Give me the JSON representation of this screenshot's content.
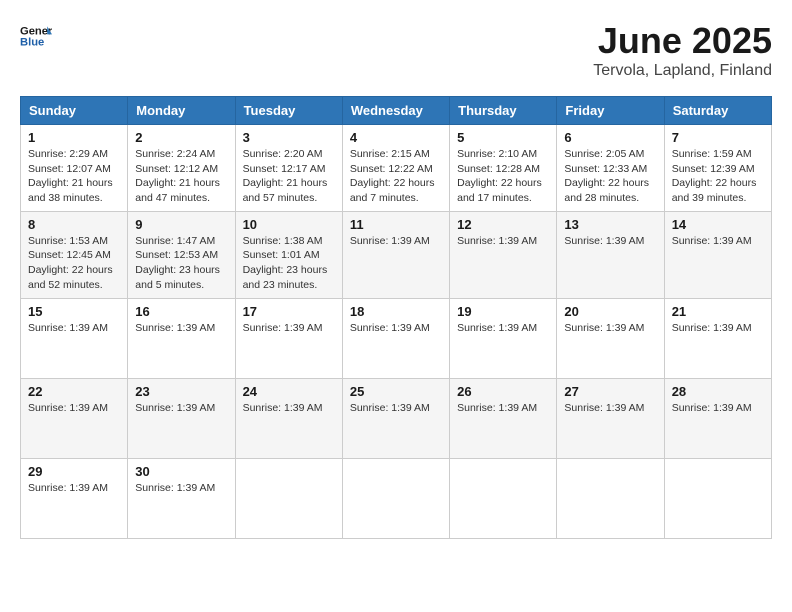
{
  "header": {
    "logo_line1": "General",
    "logo_line2": "Blue",
    "month": "June 2025",
    "location": "Tervola, Lapland, Finland"
  },
  "weekdays": [
    "Sunday",
    "Monday",
    "Tuesday",
    "Wednesday",
    "Thursday",
    "Friday",
    "Saturday"
  ],
  "weeks": [
    [
      {
        "day": "1",
        "info": "Sunrise: 2:29 AM\nSunset: 12:07 AM\nDaylight: 21 hours and 38 minutes."
      },
      {
        "day": "2",
        "info": "Sunrise: 2:24 AM\nSunset: 12:12 AM\nDaylight: 21 hours and 47 minutes."
      },
      {
        "day": "3",
        "info": "Sunrise: 2:20 AM\nSunset: 12:17 AM\nDaylight: 21 hours and 57 minutes."
      },
      {
        "day": "4",
        "info": "Sunrise: 2:15 AM\nSunset: 12:22 AM\nDaylight: 22 hours and 7 minutes."
      },
      {
        "day": "5",
        "info": "Sunrise: 2:10 AM\nSunset: 12:28 AM\nDaylight: 22 hours and 17 minutes."
      },
      {
        "day": "6",
        "info": "Sunrise: 2:05 AM\nSunset: 12:33 AM\nDaylight: 22 hours and 28 minutes."
      },
      {
        "day": "7",
        "info": "Sunrise: 1:59 AM\nSunset: 12:39 AM\nDaylight: 22 hours and 39 minutes."
      }
    ],
    [
      {
        "day": "8",
        "info": "Sunrise: 1:53 AM\nSunset: 12:45 AM\nDaylight: 22 hours and 52 minutes."
      },
      {
        "day": "9",
        "info": "Sunrise: 1:47 AM\nSunset: 12:53 AM\nDaylight: 23 hours and 5 minutes."
      },
      {
        "day": "10",
        "info": "Sunrise: 1:38 AM\nSunset: 1:01 AM\nDaylight: 23 hours and 23 minutes."
      },
      {
        "day": "11",
        "info": "Sunrise: 1:39 AM"
      },
      {
        "day": "12",
        "info": "Sunrise: 1:39 AM"
      },
      {
        "day": "13",
        "info": "Sunrise: 1:39 AM"
      },
      {
        "day": "14",
        "info": "Sunrise: 1:39 AM"
      }
    ],
    [
      {
        "day": "15",
        "info": "Sunrise: 1:39 AM"
      },
      {
        "day": "16",
        "info": "Sunrise: 1:39 AM"
      },
      {
        "day": "17",
        "info": "Sunrise: 1:39 AM"
      },
      {
        "day": "18",
        "info": "Sunrise: 1:39 AM"
      },
      {
        "day": "19",
        "info": "Sunrise: 1:39 AM"
      },
      {
        "day": "20",
        "info": "Sunrise: 1:39 AM"
      },
      {
        "day": "21",
        "info": "Sunrise: 1:39 AM"
      }
    ],
    [
      {
        "day": "22",
        "info": "Sunrise: 1:39 AM"
      },
      {
        "day": "23",
        "info": "Sunrise: 1:39 AM"
      },
      {
        "day": "24",
        "info": "Sunrise: 1:39 AM"
      },
      {
        "day": "25",
        "info": "Sunrise: 1:39 AM"
      },
      {
        "day": "26",
        "info": "Sunrise: 1:39 AM"
      },
      {
        "day": "27",
        "info": "Sunrise: 1:39 AM"
      },
      {
        "day": "28",
        "info": "Sunrise: 1:39 AM"
      }
    ],
    [
      {
        "day": "29",
        "info": "Sunrise: 1:39 AM"
      },
      {
        "day": "30",
        "info": "Sunrise: 1:39 AM"
      },
      {
        "day": "",
        "info": ""
      },
      {
        "day": "",
        "info": ""
      },
      {
        "day": "",
        "info": ""
      },
      {
        "day": "",
        "info": ""
      },
      {
        "day": "",
        "info": ""
      }
    ]
  ]
}
